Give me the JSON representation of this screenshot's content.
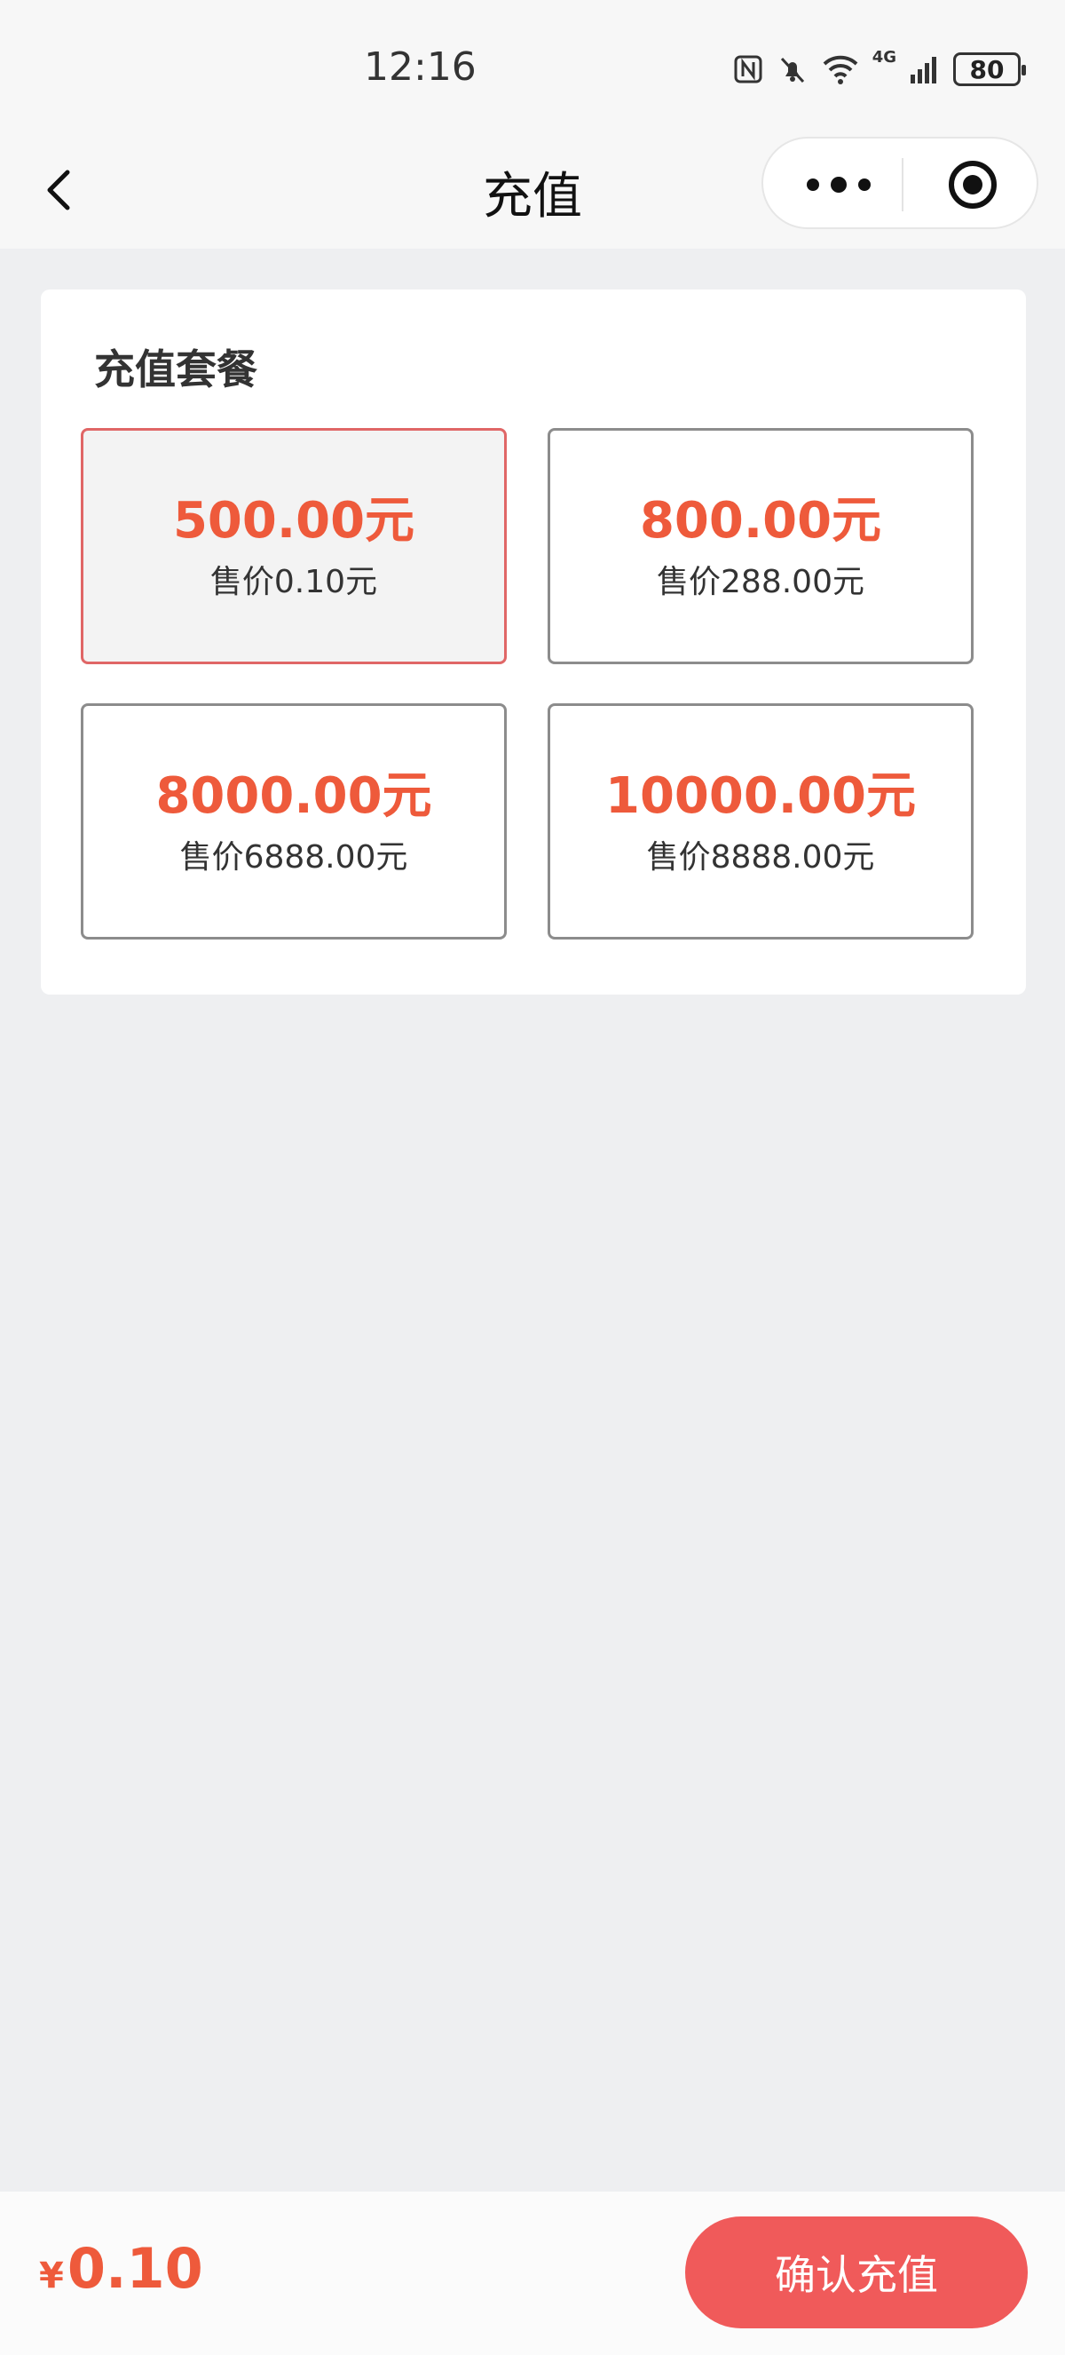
{
  "status_bar": {
    "time": "12:16",
    "network": "4G",
    "battery": "80"
  },
  "nav": {
    "title": "充值"
  },
  "recharge": {
    "section_title": "充值套餐",
    "packages": [
      {
        "amount": "500.00元",
        "price": "售价0.10元",
        "selected": true
      },
      {
        "amount": "800.00元",
        "price": "售价288.00元",
        "selected": false
      },
      {
        "amount": "8000.00元",
        "price": "售价6888.00元",
        "selected": false
      },
      {
        "amount": "10000.00元",
        "price": "售价8888.00元",
        "selected": false
      }
    ]
  },
  "footer": {
    "currency_symbol": "¥",
    "total": "0.10",
    "confirm_label": "确认充值"
  },
  "colors": {
    "accent": "#ee5a3b",
    "button": "#f05a5a",
    "selected_border": "#e06666",
    "page_bg": "#eeeff1"
  }
}
